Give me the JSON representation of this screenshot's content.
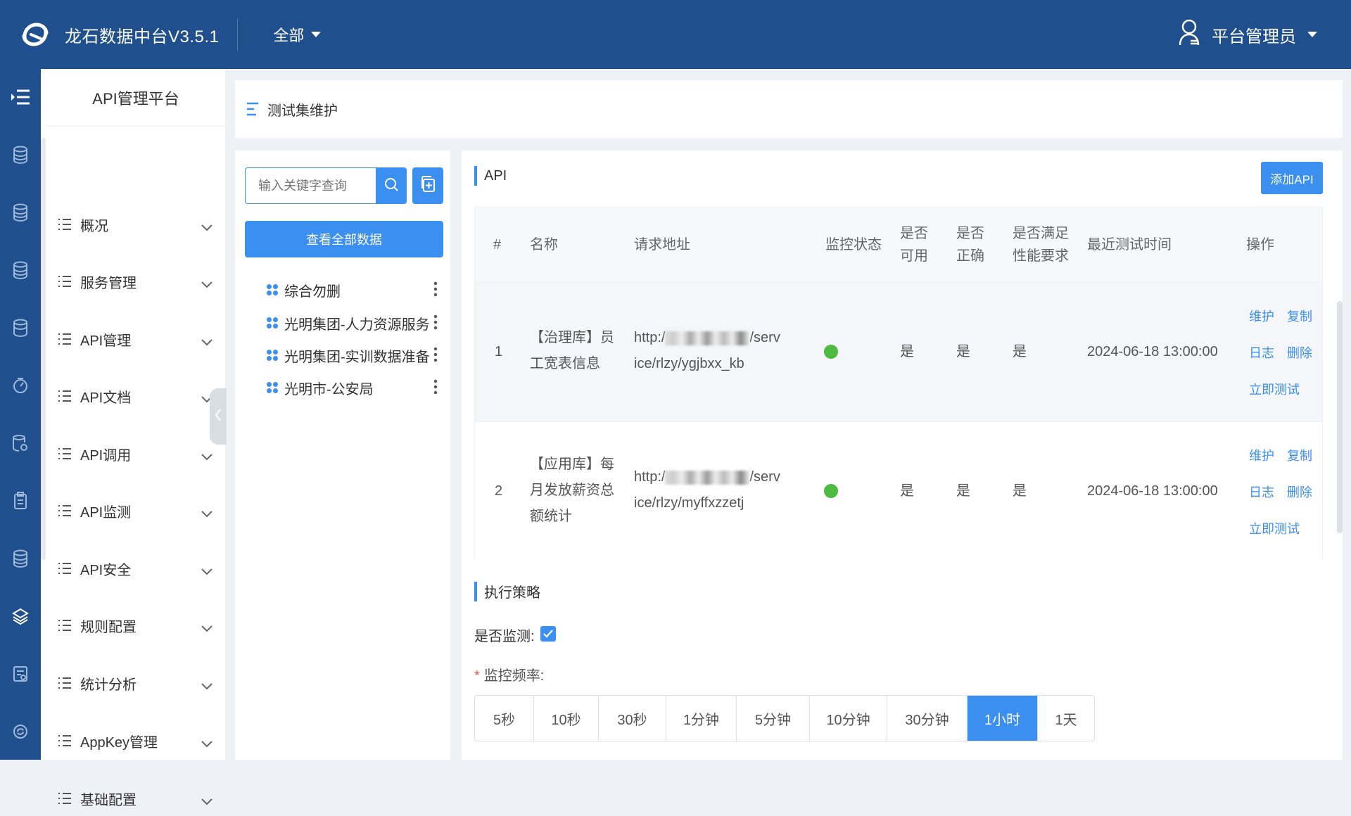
{
  "header": {
    "app_title": "龙石数据中台V3.5.1",
    "scope_label": "全部",
    "user_label": "平台管理员"
  },
  "rail": {
    "icons": [
      "menu-toggle-icon",
      "database-icon",
      "database-icon",
      "database-icon",
      "database-icon",
      "gauge-icon",
      "database-settings-icon",
      "clipboard-icon",
      "database-icon",
      "layers-icon",
      "report-icon",
      "recycle-icon"
    ]
  },
  "menu": {
    "title": "API管理平台",
    "items": [
      {
        "label": "概况"
      },
      {
        "label": "服务管理"
      },
      {
        "label": "API管理"
      },
      {
        "label": "API文档"
      },
      {
        "label": "API调用"
      },
      {
        "label": "API监测"
      },
      {
        "label": "API安全"
      },
      {
        "label": "规则配置"
      },
      {
        "label": "统计分析"
      },
      {
        "label": "AppKey管理"
      },
      {
        "label": "基础配置"
      }
    ]
  },
  "page": {
    "title": "测试集维护"
  },
  "tree": {
    "search_placeholder": "输入关键字查询",
    "view_all_label": "查看全部数据",
    "nodes": [
      {
        "label": "综合勿删"
      },
      {
        "label": "光明集团-人力资源服务"
      },
      {
        "label": "光明集团-实训数据准备"
      },
      {
        "label": "光明市-公安局"
      }
    ]
  },
  "api_section": {
    "title": "API",
    "add_label": "添加API",
    "columns": {
      "index": "#",
      "name": "名称",
      "url": "请求地址",
      "monitor": "监控状态",
      "available_1": "是否",
      "available_2": "可用",
      "correct_1": "是否",
      "correct_2": "正确",
      "perf_1": "是否满足",
      "perf_2": "性能要求",
      "last_test": "最近测试时间",
      "ops": "操作"
    },
    "rows": [
      {
        "index": "1",
        "name_1": "【治理库】员",
        "name_2": "工宽表信息",
        "url_prefix": "http:/",
        "url_suffix": "/serv",
        "url_2": "ice/rlzy/ygjbxx_kb",
        "monitor_status": "ok",
        "available": "是",
        "correct": "是",
        "perf": "是",
        "last_test": "2024-06-18 13:00:00"
      },
      {
        "index": "2",
        "name_1": "【应用库】每",
        "name_2": "月发放薪资总",
        "name_3": "额统计",
        "url_prefix": "http:/",
        "url_suffix": "/serv",
        "url_2": "ice/rlzy/myffxzzetj",
        "monitor_status": "ok",
        "available": "是",
        "correct": "是",
        "perf": "是",
        "last_test": "2024-06-18 13:00:00"
      }
    ],
    "ops": {
      "maintain": "维护",
      "copy": "复制",
      "log": "日志",
      "delete": "删除",
      "test_now": "立即测试"
    }
  },
  "strategy": {
    "title": "执行策略",
    "monitor_label": "是否监测:",
    "monitor_checked": true,
    "freq_label": "监控频率:",
    "freq_required_mark": "*",
    "freq_options": [
      "5秒",
      "10秒",
      "30秒",
      "1分钟",
      "5分钟",
      "10分钟",
      "30分钟",
      "1小时",
      "1天"
    ],
    "freq_selected": "1小时"
  },
  "colors": {
    "brand": "#1f4f8c",
    "accent": "#3b8ff0",
    "status_ok": "#4cbb3f"
  }
}
